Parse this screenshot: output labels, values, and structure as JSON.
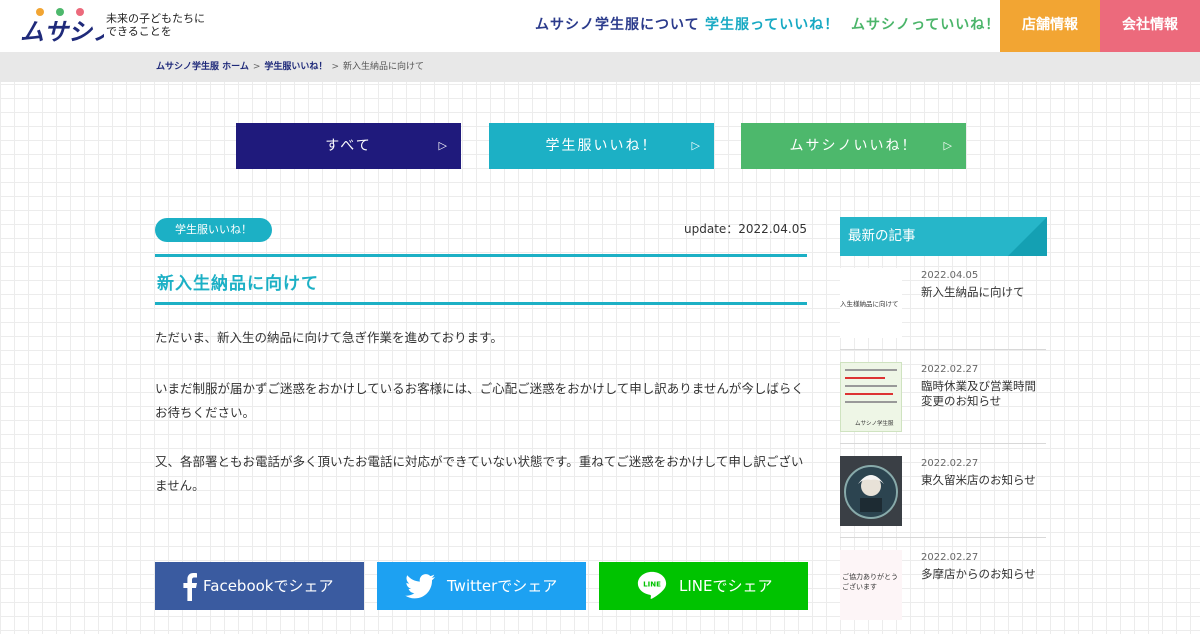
{
  "header": {
    "logo_text": "ムサシノ",
    "tagline_line1": "未来の子どもたちに",
    "tagline_line2": "できることを",
    "nav": [
      {
        "label": "ムサシノ学生服について"
      },
      {
        "label": "学生服っていいね！"
      },
      {
        "label": "ムサシノっていいね！"
      }
    ],
    "shop_label": "店舗情報",
    "company_label": "会社情報"
  },
  "breadcrumb": {
    "home": "ムサシノ学生服 ホーム",
    "category": "学生服いいね！",
    "current": "新入生納品に向けて",
    "separator": ">"
  },
  "categories": {
    "all": "すべて",
    "uniform": "学生服いいね！",
    "musashino": "ムサシノいいね！",
    "arrow": "▷"
  },
  "article": {
    "tag": "学生服いいね！",
    "update": "update：2022.04.05",
    "title": "新入生納品に向けて",
    "p1": "ただいま、新入生の納品に向けて急ぎ作業を進めております。",
    "p2": "いまだ制服が届かずご迷惑をおかけしているお客様には、ご心配ご迷惑をおかけして申し訳ありませんが今しばらくお待ちください。",
    "p3": "又、各部署ともお電話が多く頂いたお電話に対応ができていない状態です。重ねてご迷惑をおかけして申し訳ございません。"
  },
  "share": {
    "facebook": "Facebookでシェア",
    "twitter": "Twitterでシェア",
    "line": "LINEでシェア",
    "line_icon_text": "LINE"
  },
  "sidebar": {
    "heading": "最新の記事",
    "items": [
      {
        "date": "2022.04.05",
        "title": "新入生納品に向けて",
        "thumb_text": "入生様納品に向けて"
      },
      {
        "date": "2022.02.27",
        "title": "臨時休業及び営業時間変更のお知らせ",
        "thumb_text": "ムサシノ学生服"
      },
      {
        "date": "2022.02.27",
        "title": "東久留米店のお知らせ",
        "thumb_text": ""
      },
      {
        "date": "2022.02.27",
        "title": "多摩店からのお知らせ",
        "thumb_text": "ご協力ありがとうございます"
      }
    ]
  },
  "colors": {
    "navy": "#1f1a7c",
    "teal": "#1cb0c5",
    "green": "#4db86c",
    "orange": "#f2a533",
    "pink": "#ec6a7c",
    "facebook": "#3a5ba0",
    "twitter": "#1da1f2",
    "line": "#00c300"
  }
}
